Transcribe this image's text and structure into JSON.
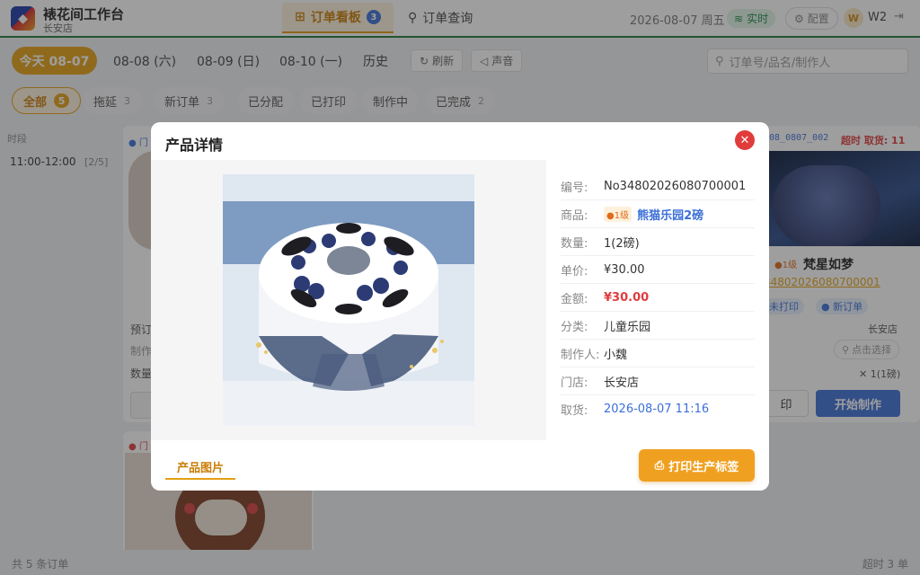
{
  "header": {
    "app_title": "裱花间工作台",
    "store": "长安店",
    "tab_board": "订单看板",
    "tab_board_count": "3",
    "tab_query": "订单查询",
    "date": "2026-08-07 周五",
    "live": "实时",
    "config": "配置",
    "avatar_letter": "W",
    "user": "W2"
  },
  "dates": {
    "today": "今天 08-07",
    "d1": "08-08 (六)",
    "d2": "08-09 (日)",
    "d3": "08-10 (一)",
    "history": "历史",
    "refresh": "刷新",
    "sound": "声音",
    "search_placeholder": "订单号/品名/制作人"
  },
  "filters": [
    {
      "label": "全部",
      "count": "5"
    },
    {
      "label": "拖延",
      "count": "3"
    },
    {
      "label": "新订单",
      "count": "3"
    },
    {
      "label": "已分配",
      "count": ""
    },
    {
      "label": "已打印",
      "count": ""
    },
    {
      "label": "制作中",
      "count": ""
    },
    {
      "label": "已完成",
      "count": "2"
    }
  ],
  "sidebar": {
    "heading": "时段",
    "slot": "11:00-12:00",
    "slot_count": "[2/5]"
  },
  "bg_card_left": {
    "tag": "● 门",
    "line1": "预订",
    "line2": "制作",
    "line3": "数量"
  },
  "bg_card_left2": {
    "tag": "● 门"
  },
  "bg_card_right": {
    "order_snippet": "608_0807_002",
    "overdue": "超时 取货: 11",
    "level": "●1级",
    "product": "梵星如梦",
    "order_no": "34802026080700001",
    "badge1": "未打印",
    "badge2": "● 新订单",
    "store": "长安店",
    "assign": "点击选择",
    "qty": "✕ 1(1磅)",
    "print": "印",
    "start": "开始制作"
  },
  "footer": {
    "total": "共 5 条订单",
    "overdue": "超时 3 单"
  },
  "modal": {
    "title": "产品详情",
    "rows": [
      {
        "k": "编号:",
        "v": "No34802026080700001"
      },
      {
        "k": "商品:",
        "lvl": "●1级",
        "v": "熊猫乐园2磅"
      },
      {
        "k": "数量:",
        "v": "1(2磅)"
      },
      {
        "k": "单价:",
        "v": "¥30.00"
      },
      {
        "k": "金额:",
        "v": "¥30.00"
      },
      {
        "k": "分类:",
        "v": "儿童乐园"
      },
      {
        "k": "制作人:",
        "v": "小魏"
      },
      {
        "k": "门店:",
        "v": "长安店"
      },
      {
        "k": "取货:",
        "v": "2026-08-07 11:16"
      }
    ],
    "tab": "产品图片",
    "print_button": "打印生产标签"
  },
  "colors": {
    "accent": "#e3a015",
    "blue": "#3b6fd8",
    "red": "#e03c3c",
    "green": "#1e7b3a"
  }
}
